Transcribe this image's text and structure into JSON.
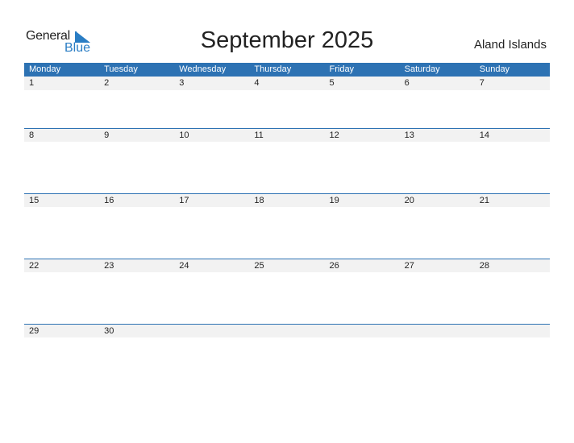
{
  "logo": {
    "word1": "General",
    "word2": "Blue"
  },
  "title": "September 2025",
  "country": "Aland Islands",
  "weekdays": [
    "Monday",
    "Tuesday",
    "Wednesday",
    "Thursday",
    "Friday",
    "Saturday",
    "Sunday"
  ],
  "weeks": [
    [
      "1",
      "2",
      "3",
      "4",
      "5",
      "6",
      "7"
    ],
    [
      "8",
      "9",
      "10",
      "11",
      "12",
      "13",
      "14"
    ],
    [
      "15",
      "16",
      "17",
      "18",
      "19",
      "20",
      "21"
    ],
    [
      "22",
      "23",
      "24",
      "25",
      "26",
      "27",
      "28"
    ],
    [
      "29",
      "30",
      "",
      "",
      "",
      "",
      ""
    ]
  ],
  "colors": {
    "header": "#2d72b3",
    "brand": "#2a7dc4",
    "strip": "#f2f2f2"
  }
}
